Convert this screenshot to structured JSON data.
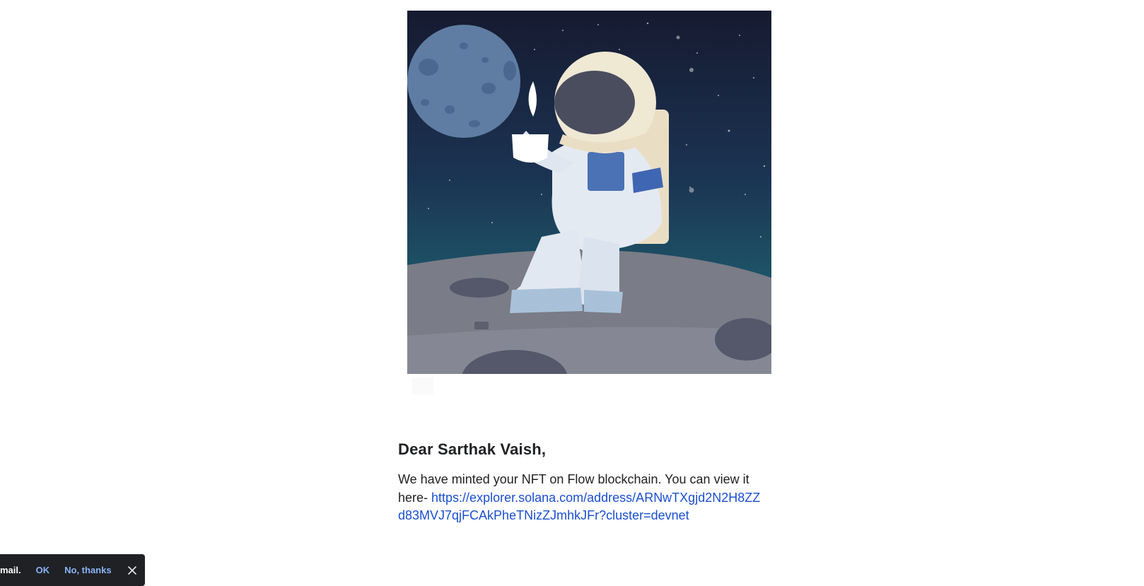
{
  "email": {
    "nft_image_alt": "Astronaut sitting on the moon holding a cup of coffee",
    "greeting": "Dear Sarthak Vaish,",
    "message": "We have minted your NFT on Flow blockchain. You can view it here- ",
    "link_text": "https://explorer.solana.com/address/ARNwTXgjd2N2H8ZZd83MVJ7qjFCAkPheTNizZJmhkJFr?cluster=devnet"
  },
  "snackbar": {
    "message": "mail.",
    "ok_label": "OK",
    "decline_label": "No, thanks",
    "close_icon": "close-icon"
  },
  "colors": {
    "link": "#1a4fd1",
    "snackbar_bg": "#202124",
    "snackbar_action": "#8ab4f8",
    "text": "#202124"
  }
}
